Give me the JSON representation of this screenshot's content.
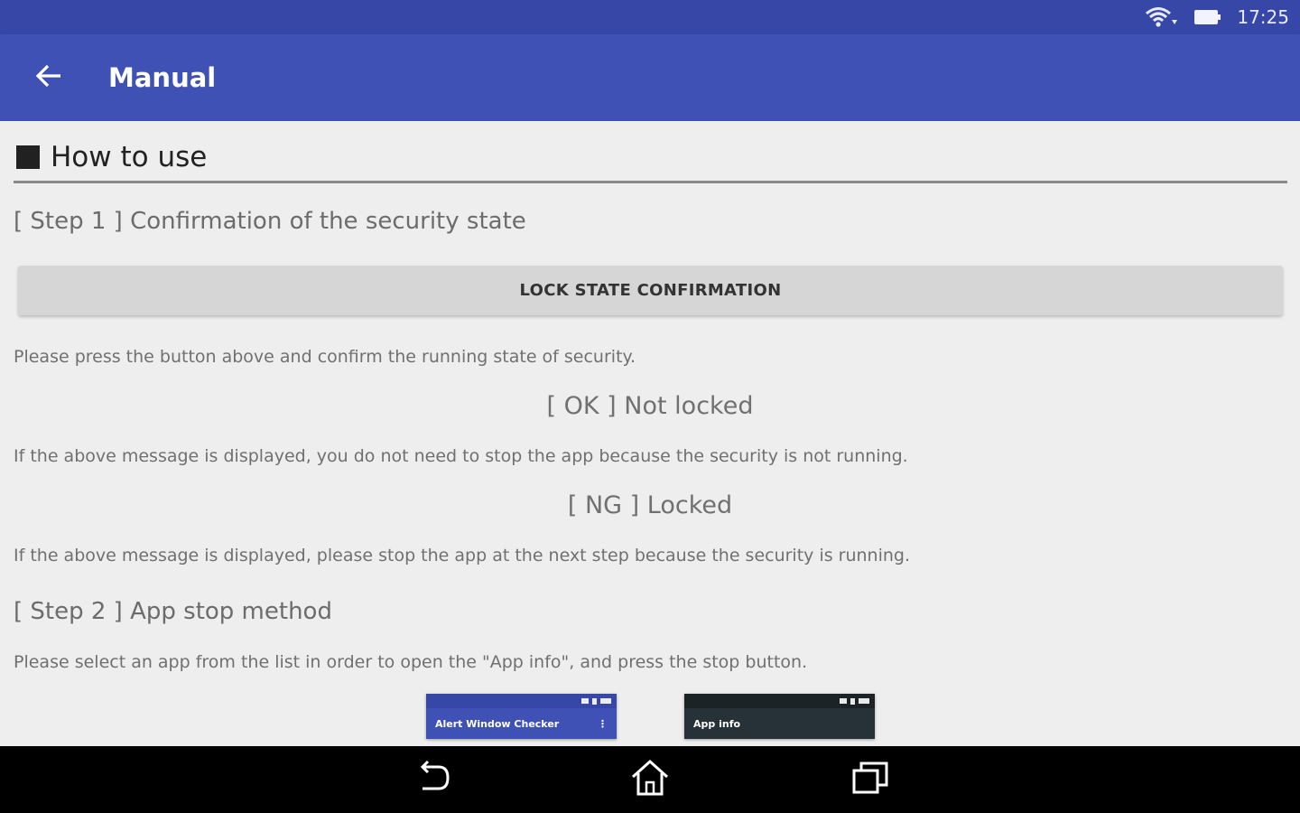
{
  "status_bar": {
    "time": "17:25",
    "icons": [
      "wifi-icon",
      "battery-icon"
    ]
  },
  "app_bar": {
    "back_icon": "arrow-left-icon",
    "title": "Manual"
  },
  "section": {
    "title": "How to use"
  },
  "step1": {
    "title": "[ Step 1 ] Confirmation of the security state",
    "button_label": "LOCK STATE CONFIRMATION",
    "instruction": "Please press the button above and confirm the running state of security.",
    "ok_result": "[ OK ] Not locked",
    "ok_description": "If the above message is displayed, you do not need to stop the app because the security is not running.",
    "ng_result": "[ NG ] Locked",
    "ng_description": "If the above message is displayed, please stop the app at the next step because the security is running."
  },
  "step2": {
    "title": "[ Step 2 ] App stop method",
    "instruction": "Please select an app from the list in order to open the \"App info\", and press the stop button.",
    "screenshots": [
      {
        "title": "Alert Window Checker",
        "color": "#3f51b5"
      },
      {
        "title": "App info",
        "color": "#263238"
      }
    ]
  },
  "nav_bar": {
    "icons": [
      "back-icon",
      "home-icon",
      "recents-icon"
    ]
  },
  "colors": {
    "primary": "#3f51b5",
    "primary_dark": "#3647a7",
    "background": "#eeeeee"
  }
}
